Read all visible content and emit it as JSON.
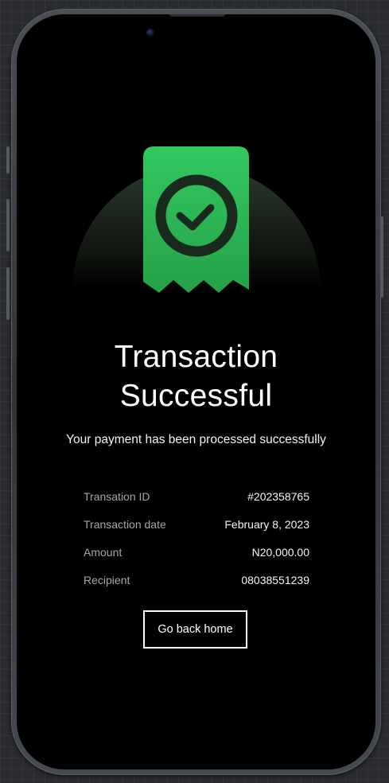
{
  "status": {
    "title_line1": "Transaction",
    "title_line2": "Successful",
    "subtitle": "Your payment has been processed successfully",
    "icon": "receipt-check-icon",
    "accent_color": "#32c55e"
  },
  "details": [
    {
      "label": "Transation ID",
      "value": "#202358765"
    },
    {
      "label": "Transaction date",
      "value": "February 8, 2023"
    },
    {
      "label": "Amount",
      "value": "N20,000.00"
    },
    {
      "label": "Recipient",
      "value": "08038551239"
    }
  ],
  "actions": {
    "home_label": "Go back home"
  }
}
